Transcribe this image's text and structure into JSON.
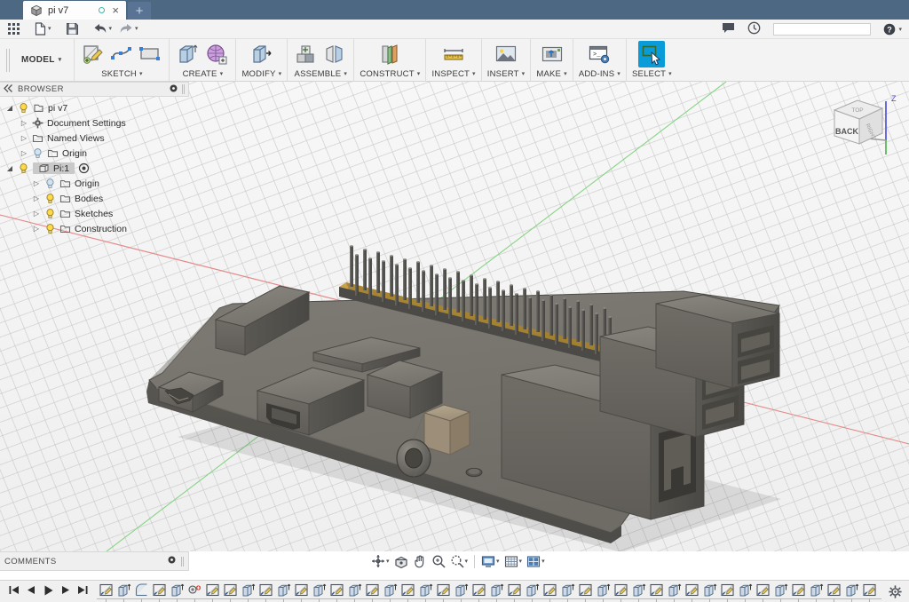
{
  "window": {
    "tab_title": "pi v7",
    "tab_close_label": "×",
    "new_tab_label": "+",
    "unsaved_indicator": "○"
  },
  "quick_access": {
    "items": [
      {
        "name": "app-grid-button",
        "label": "",
        "icon": "grid-icon"
      },
      {
        "name": "file-menu-button",
        "label": "",
        "icon": "file-icon",
        "caret": "▾"
      },
      {
        "name": "save-button",
        "label": "",
        "icon": "save-icon"
      },
      {
        "name": "undo-button",
        "label": "",
        "icon": "undo-icon",
        "caret": "▾"
      },
      {
        "name": "redo-button",
        "label": "",
        "icon": "redo-icon",
        "caret": "▾"
      }
    ]
  },
  "top_right": {
    "comment_icon": "comment-icon",
    "history_icon": "clock-icon",
    "search_value": "",
    "search_placeholder": "",
    "help_label": "?",
    "help_caret": "▾"
  },
  "ribbon": {
    "workspace_label": "MODEL",
    "workspace_caret": "▾",
    "groups": [
      {
        "label": "SKETCH",
        "caret": "▾",
        "buttons": [
          "create-sketch-icon",
          "spline-icon",
          "rectangle-icon"
        ],
        "active": false
      },
      {
        "label": "CREATE",
        "caret": "▾",
        "buttons": [
          "extrude-icon",
          "mesh-icon"
        ],
        "active": false
      },
      {
        "label": "MODIFY",
        "caret": "▾",
        "buttons": [
          "press-pull-icon"
        ],
        "active": false
      },
      {
        "label": "ASSEMBLE",
        "caret": "▾",
        "buttons": [
          "new-component-icon",
          "joint-icon"
        ],
        "active": false
      },
      {
        "label": "CONSTRUCT",
        "caret": "▾",
        "buttons": [
          "offset-plane-icon"
        ],
        "active": false
      },
      {
        "label": "INSPECT",
        "caret": "▾",
        "buttons": [
          "measure-icon"
        ],
        "active": false
      },
      {
        "label": "INSERT",
        "caret": "▾",
        "buttons": [
          "insert-image-icon"
        ],
        "active": false
      },
      {
        "label": "MAKE",
        "caret": "▾",
        "buttons": [
          "3d-print-icon"
        ],
        "active": false
      },
      {
        "label": "ADD-INS",
        "caret": "▾",
        "buttons": [
          "scripts-addins-icon"
        ],
        "active": false
      },
      {
        "label": "SELECT",
        "caret": "▾",
        "buttons": [
          "select-cursor-icon"
        ],
        "active": true
      }
    ]
  },
  "browser": {
    "title": "BROWSER",
    "collapse_icon": "collapse-left-icon",
    "options_icon": "panel-options-icon",
    "tree": [
      {
        "label": "pi v7",
        "depth": 0,
        "arrow": "◢",
        "icons": [
          "lightbulb-on-icon",
          "document-icon"
        ],
        "selected": false
      },
      {
        "label": "Document Settings",
        "depth": 1,
        "arrow": "▷",
        "icons": [
          "gear-icon"
        ],
        "selected": false
      },
      {
        "label": "Named Views",
        "depth": 1,
        "arrow": "▷",
        "icons": [
          "folder-icon"
        ],
        "selected": false
      },
      {
        "label": "Origin",
        "depth": 1,
        "arrow": "▷",
        "icons": [
          "lightbulb-off-icon",
          "folder-icon"
        ],
        "selected": false
      },
      {
        "label": "Pi:1",
        "depth": 1,
        "arrow": "◢",
        "icons": [
          "lightbulb-on-icon",
          "component-icon"
        ],
        "selected": true,
        "trailing_icon": "activate-component-icon"
      },
      {
        "label": "Origin",
        "depth": 2,
        "arrow": "▷",
        "icons": [
          "lightbulb-off-icon",
          "folder-icon"
        ],
        "selected": false
      },
      {
        "label": "Bodies",
        "depth": 2,
        "arrow": "▷",
        "icons": [
          "lightbulb-on-icon",
          "folder-icon"
        ],
        "selected": false
      },
      {
        "label": "Sketches",
        "depth": 2,
        "arrow": "▷",
        "icons": [
          "lightbulb-on-icon",
          "folder-icon"
        ],
        "selected": false
      },
      {
        "label": "Construction",
        "depth": 2,
        "arrow": "▷",
        "icons": [
          "lightbulb-on-icon",
          "folder-icon"
        ],
        "selected": false
      }
    ]
  },
  "comments": {
    "title": "COMMENTS",
    "options_icon": "panel-options-icon"
  },
  "viewcube": {
    "face_label": "BACK",
    "top_label": "TOP",
    "right_label": "RIGHT",
    "axis_z_label": "Z"
  },
  "navbar": {
    "buttons": [
      {
        "name": "orbit-button",
        "icon": "orbit-icon",
        "caret": "▾"
      },
      {
        "name": "look-at-button",
        "icon": "look-at-icon",
        "caret": ""
      },
      {
        "name": "pan-button",
        "icon": "pan-hand-icon",
        "caret": ""
      },
      {
        "name": "zoom-fit-button",
        "icon": "zoom-fit-icon",
        "caret": ""
      },
      {
        "name": "zoom-button",
        "icon": "magnifier-icon",
        "caret": "▾"
      },
      {
        "name": "display-settings-button",
        "icon": "display-settings-icon",
        "caret": "▾"
      },
      {
        "name": "grid-snaps-button",
        "icon": "grid-snaps-icon",
        "caret": "▾"
      },
      {
        "name": "viewports-button",
        "icon": "viewports-icon",
        "caret": "▾"
      }
    ]
  },
  "timeline": {
    "playback": [
      {
        "name": "timeline-jump-start-button",
        "icon": "skip-back-icon"
      },
      {
        "name": "timeline-step-back-button",
        "icon": "step-back-icon"
      },
      {
        "name": "timeline-play-button",
        "icon": "play-icon"
      },
      {
        "name": "timeline-step-forward-button",
        "icon": "step-forward-icon"
      },
      {
        "name": "timeline-jump-end-button",
        "icon": "skip-forward-icon"
      }
    ],
    "settings_icon": "gear-icon",
    "features": [
      "sketch",
      "extrude",
      "fillet",
      "sketch",
      "extrude",
      "hole",
      "sketch",
      "sketch",
      "extrude",
      "sketch",
      "extrude",
      "sketch",
      "extrude",
      "sketch",
      "extrude",
      "sketch",
      "extrude",
      "sketch",
      "extrude",
      "sketch",
      "extrude",
      "sketch",
      "extrude",
      "sketch",
      "extrude",
      "sketch",
      "extrude",
      "sketch",
      "extrude",
      "sketch",
      "extrude",
      "sketch",
      "extrude",
      "sketch",
      "extrude",
      "sketch",
      "extrude",
      "sketch",
      "extrude",
      "sketch",
      "extrude",
      "sketch",
      "extrude",
      "sketch",
      "extrude"
    ]
  },
  "model": {
    "name": "raspberry-pi-board",
    "body_color": "#6d6a64",
    "body_top_color": "#7a7771",
    "header_pad_color": "#b08d3c",
    "pin_color": "#5a5853",
    "jack_color": "#a0917c",
    "gpio_pin_columns": 20,
    "gpio_pin_rows": 2
  },
  "colors": {
    "titlebar": "#4d6883",
    "accent_active": "#0a9cd9",
    "panel": "#f0f0f0",
    "canvas_bg": "#f3f3f3",
    "grid_line": "#c4c4c4",
    "axis_x": "#e06666",
    "axis_y": "#68c168",
    "axis_z": "#6a6ae0"
  }
}
